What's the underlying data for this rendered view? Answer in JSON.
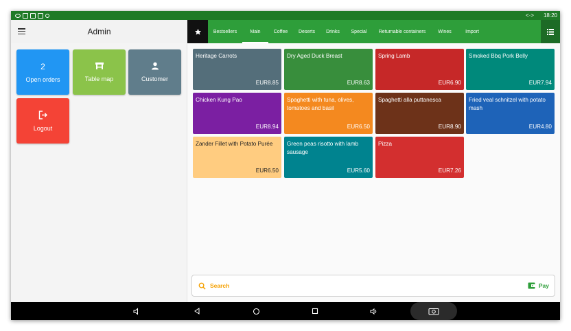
{
  "status_bar": {
    "time": "18:20",
    "sync_symbol": "<·>"
  },
  "left_header": {
    "title": "Admin"
  },
  "tiles": {
    "open_orders": {
      "count": "2",
      "label": "Open orders",
      "color": "#2196f3"
    },
    "table_map": {
      "label": "Table map",
      "color": "#8bc34a"
    },
    "customer": {
      "label": "Customer",
      "color": "#607d8b"
    },
    "logout": {
      "label": "Logout",
      "color": "#f44336"
    }
  },
  "tabs": [
    {
      "label": "Bestsellers"
    },
    {
      "label": "Main",
      "active": true
    },
    {
      "label": "Coffee"
    },
    {
      "label": "Deserts"
    },
    {
      "label": "Drinks"
    },
    {
      "label": "Special"
    },
    {
      "label": "Returnable containers"
    },
    {
      "label": "Wines"
    },
    {
      "label": "Import"
    }
  ],
  "products": [
    {
      "name": "Heritage Carrots",
      "price": "EUR8.85",
      "color": "#546e7a"
    },
    {
      "name": "Dry Aged Duck Breast",
      "price": "EUR8.63",
      "color": "#388e3c"
    },
    {
      "name": "Spring Lamb",
      "price": "EUR6.90",
      "color": "#c62828"
    },
    {
      "name": "Smoked Bbq Pork Belly",
      "price": "EUR7.94",
      "color": "#00897b"
    },
    {
      "name": "Chicken Kung Pao",
      "price": "EUR8.94",
      "color": "#7b1fa2"
    },
    {
      "name": "Spaghetti with tuna, olives, tomatoes and basil",
      "price": "EUR6.50",
      "color": "#f4891f"
    },
    {
      "name": "Spaghetti alla puttanesca",
      "price": "EUR8.90",
      "color": "#6d3219"
    },
    {
      "name": "Fried veal schnitzel with potato mash",
      "price": "EUR4.80",
      "color": "#1e63b8"
    },
    {
      "name": "Zander Fillet with Potato Purée",
      "price": "EUR6.50",
      "color": "#ffcc80"
    },
    {
      "name": "Green peas risotto with lamb sausage",
      "price": "EUR5.60",
      "color": "#00838f"
    },
    {
      "name": "Pizza",
      "price": "EUR7.26",
      "color": "#d32f2f"
    }
  ],
  "search": {
    "label": "Search"
  },
  "pay": {
    "label": "Pay"
  },
  "colors": {
    "status_bar": "#1f7a27",
    "tab_bar": "#2e9e3a",
    "accent_search": "#f5a000",
    "pay": "#2e9e3a"
  },
  "icons": [
    "menu-icon",
    "star-icon",
    "list-icon",
    "table-icon",
    "person-icon",
    "logout-icon",
    "search-icon",
    "wallet-icon",
    "volume-icon",
    "back-icon",
    "home-icon",
    "recents-icon",
    "camera-icon"
  ]
}
